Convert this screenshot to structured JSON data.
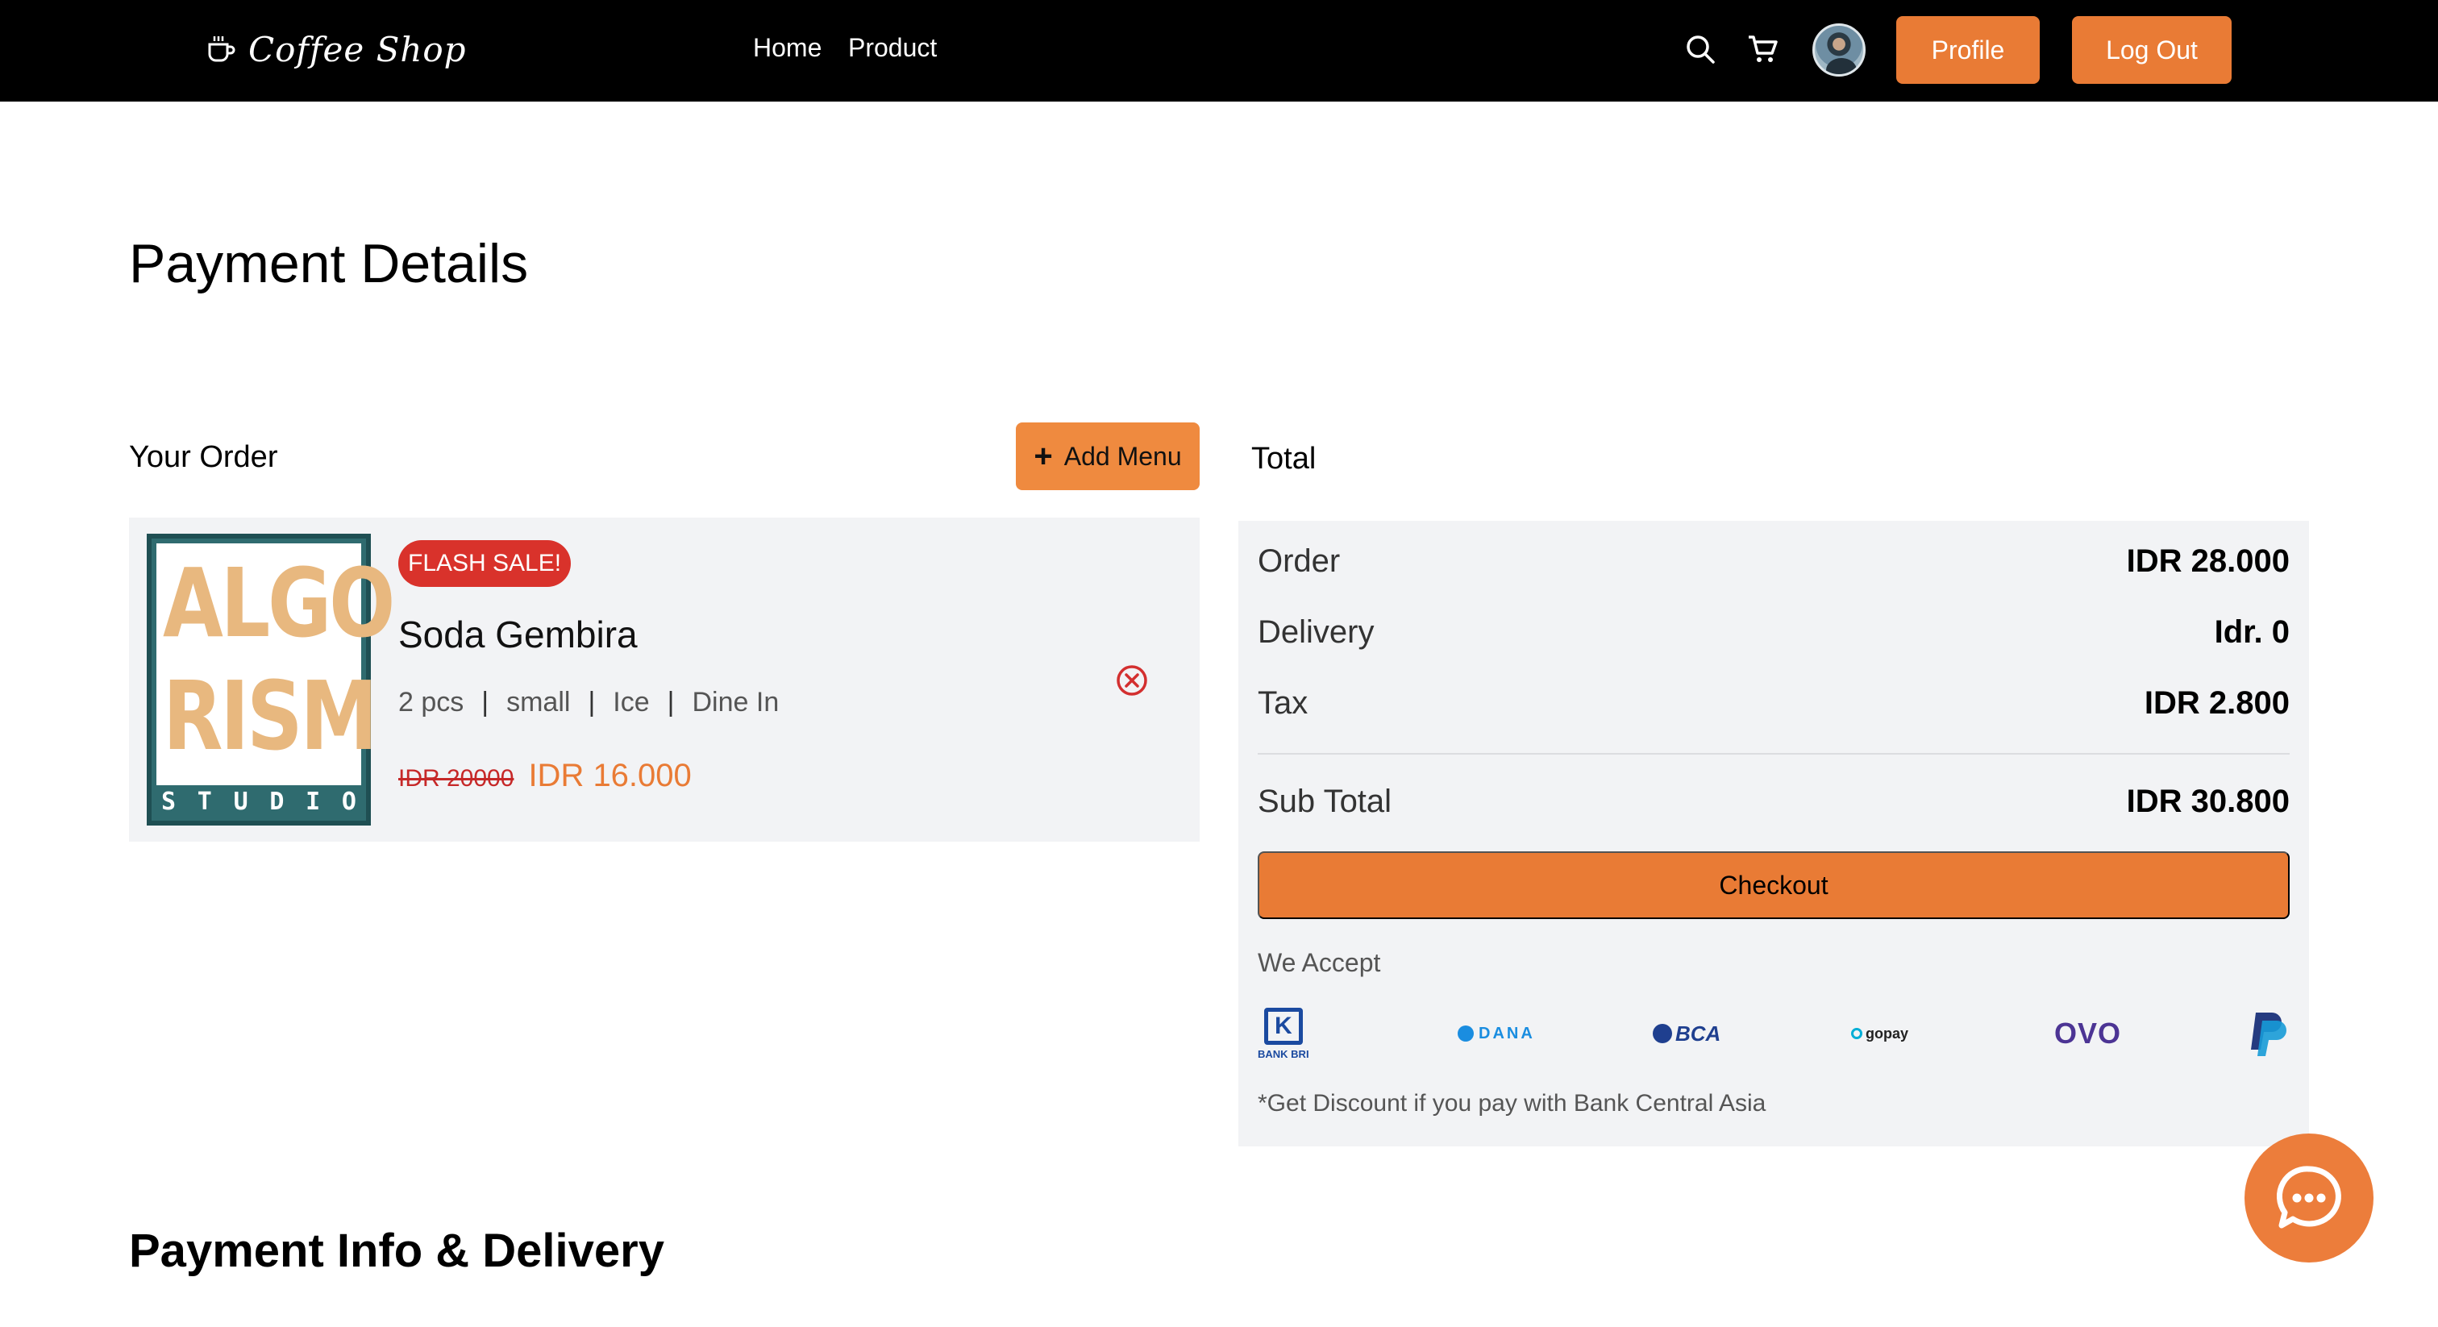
{
  "navbar": {
    "brand": "Coffee Shop",
    "links": [
      "Home",
      "Product"
    ],
    "profile_label": "Profile",
    "logout_label": "Log Out"
  },
  "page": {
    "title": "Payment Details",
    "your_order_title": "Your Order",
    "add_menu_label": "Add Menu",
    "total_title": "Total",
    "payment_info_title": "Payment Info & Delivery"
  },
  "order_item": {
    "badge": "FLASH SALE!",
    "image_text": {
      "line1": "ALGO",
      "line2": "RISM",
      "studio": [
        "S",
        "T",
        "U",
        "D",
        "I",
        "O"
      ]
    },
    "name": "Soda Gembira",
    "quantity": "2 pcs",
    "size": "small",
    "temperature": "Ice",
    "dine": "Dine In",
    "separator": "|",
    "old_price": "IDR 20000",
    "price": "IDR 16.000"
  },
  "total": {
    "order_label": "Order",
    "order_value": "IDR 28.000",
    "delivery_label": "Delivery",
    "delivery_value": "Idr. 0",
    "tax_label": "Tax",
    "tax_value": "IDR 2.800",
    "subtotal_label": "Sub Total",
    "subtotal_value": "IDR 30.800",
    "checkout_label": "Checkout",
    "we_accept": "We Accept",
    "payment_methods": {
      "bri_mark": "K",
      "bri": "BANK BRI",
      "dana": "DANA",
      "bca": "BCA",
      "gopay": "gopay",
      "ovo": "OVO"
    },
    "discount_note": "*Get Discount if you pay with Bank Central Asia"
  },
  "colors": {
    "accent": "#e97b35",
    "navbar_bg": "#000000",
    "card_bg": "#f2f3f5",
    "badge_red": "#d9322b"
  },
  "icons": [
    "coffee-cup-icon",
    "search-icon",
    "cart-icon",
    "plus-icon",
    "remove-circle-icon",
    "chat-icon",
    "paypal-icon"
  ]
}
